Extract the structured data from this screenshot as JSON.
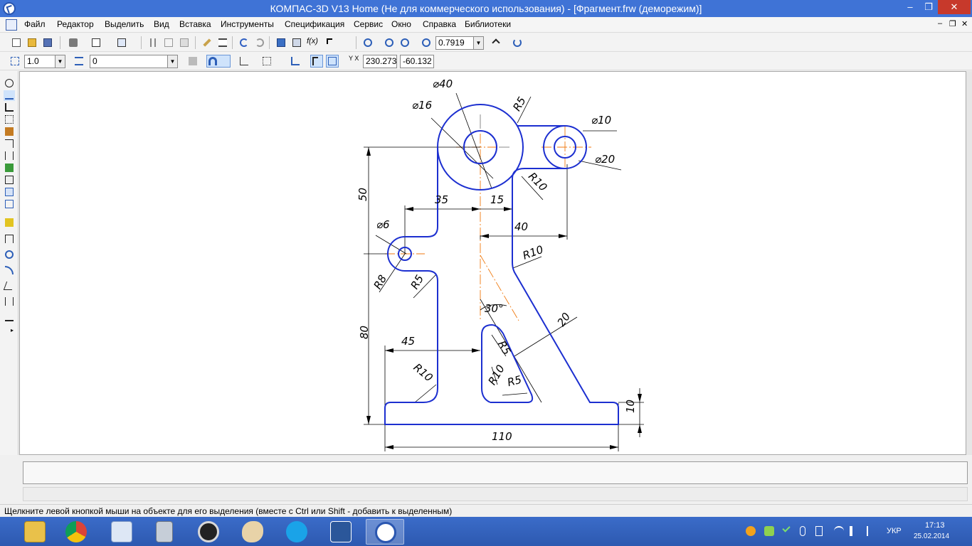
{
  "window": {
    "title": "КОМПАС-3D V13 Home (Не для коммерческого использования) - [Фрагмент.frw (деморежим)]",
    "min_glyph": "–",
    "max_glyph": "❐",
    "close_glyph": "✕"
  },
  "menu": {
    "items": [
      "Файл",
      "Редактор",
      "Выделить",
      "Вид",
      "Вставка",
      "Инструменты",
      "Спецификация",
      "Сервис",
      "Окно",
      "Справка",
      "Библиотеки"
    ],
    "mdi_min": "–",
    "mdi_restore": "❐",
    "mdi_close": "✕"
  },
  "toolbar1": {
    "zoom_value": "0.7919"
  },
  "toolbar2": {
    "step_value": "1.0",
    "layer_value": "0",
    "coord_x": "230.273",
    "coord_y": "-60.132",
    "coord_label": "Y X"
  },
  "drawing": {
    "dims": {
      "d40": "⌀40",
      "d16": "⌀16",
      "r5_top": "R5",
      "d10": "⌀10",
      "d20": "⌀20",
      "r10_right": "R10",
      "v50": "50",
      "h35": "35",
      "h15": "15",
      "h40": "40",
      "d6": "⌀6",
      "r10_mid": "R10",
      "r8": "R8",
      "r5_left": "R5",
      "ang30": "30°",
      "w20": "20",
      "v80": "80",
      "h45": "45",
      "r5_slot_top": "R5",
      "r10_slot": "R10",
      "r5_slot": "R5",
      "r10_base": "R10",
      "v10": "10",
      "h110": "110"
    }
  },
  "status": {
    "hint": "Щелкните левой кнопкой мыши на объекте для его выделения (вместе с Ctrl или Shift - добавить к выделенным)"
  },
  "taskbar": {
    "apps": [
      "file-explorer",
      "chrome",
      "task-manager",
      "calculator",
      "camera",
      "paint",
      "skype",
      "word",
      "kompas"
    ],
    "lang": "УКР",
    "time": "17:13",
    "date": "25.02.2014"
  },
  "colors": {
    "title": "#3f73d6",
    "contour": "#1c2fd0",
    "axis": "#f07a10",
    "taskbar": "#2d59b0"
  }
}
